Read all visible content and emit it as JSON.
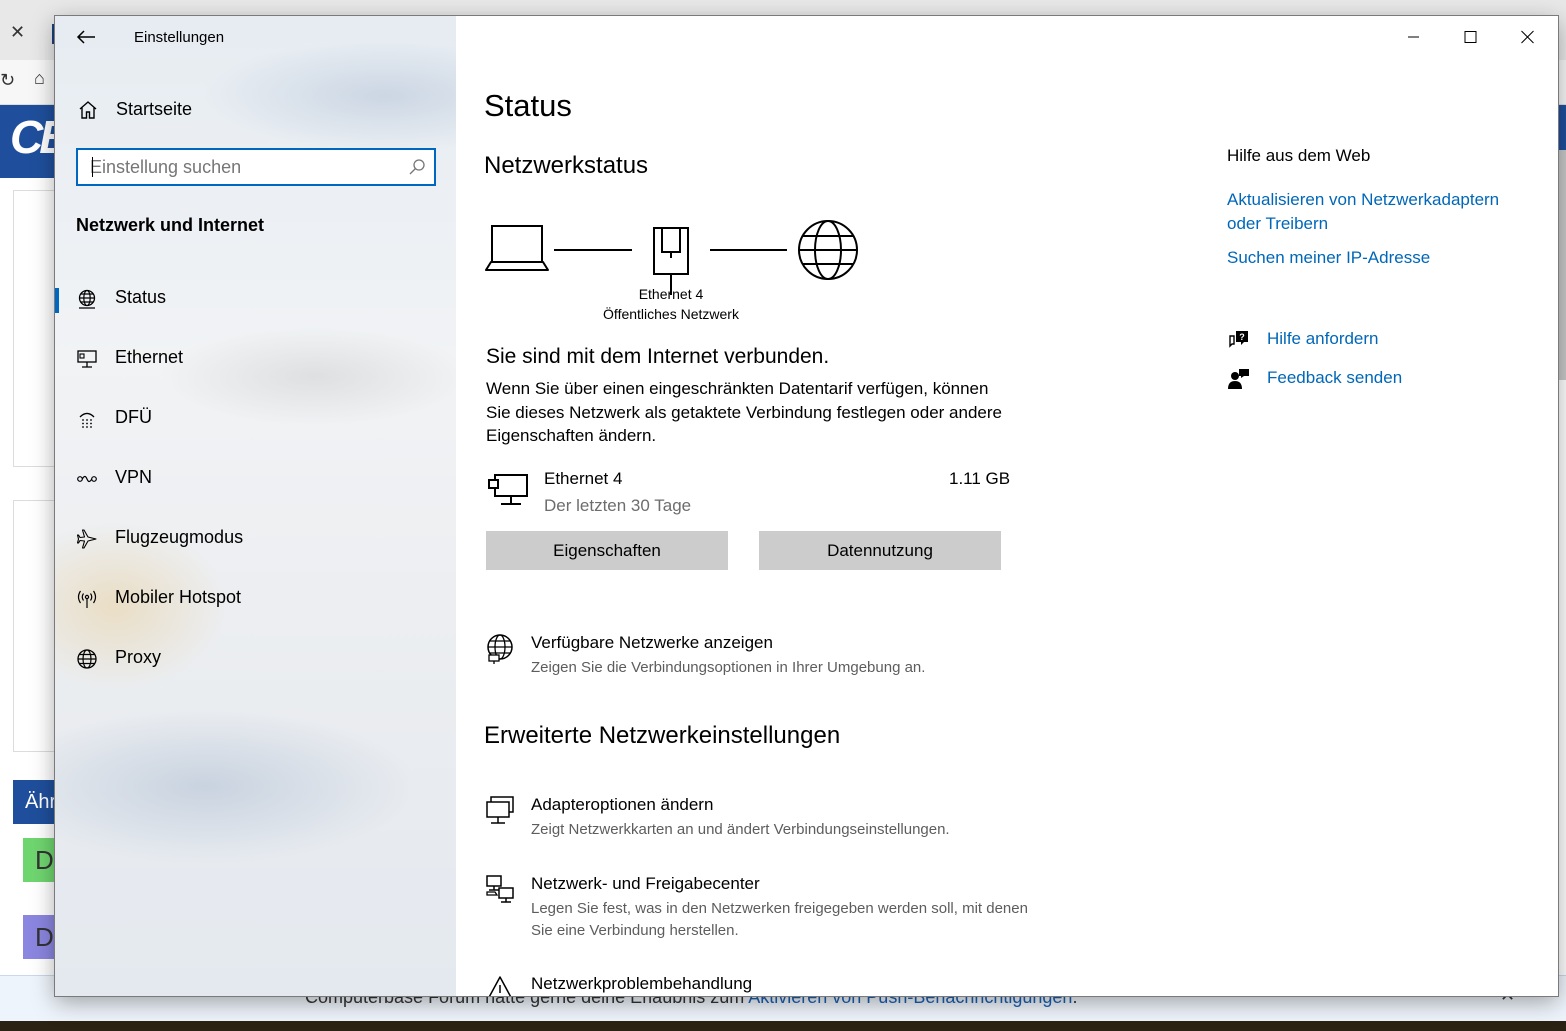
{
  "background": {
    "logo_text": "CB",
    "similar_label": "Ähr",
    "avatar1": "D",
    "avatar2": "D",
    "notification_text": "Computerbase Forum hätte gerne deine Erlaubnis zum ",
    "notification_link": "Aktivieren von Push-Benachrichtigungen",
    "notification_end": "."
  },
  "window": {
    "title": "Einstellungen"
  },
  "sidebar": {
    "home_label": "Startseite",
    "search_placeholder": "Einstellung suchen",
    "section_title": "Netzwerk und Internet",
    "items": [
      {
        "label": "Status",
        "icon": "globe-network-icon",
        "selected": true
      },
      {
        "label": "Ethernet",
        "icon": "ethernet-icon",
        "selected": false
      },
      {
        "label": "DFÜ",
        "icon": "dialup-icon",
        "selected": false
      },
      {
        "label": "VPN",
        "icon": "vpn-icon",
        "selected": false
      },
      {
        "label": "Flugzeugmodus",
        "icon": "airplane-icon",
        "selected": false
      },
      {
        "label": "Mobiler Hotspot",
        "icon": "hotspot-icon",
        "selected": false
      },
      {
        "label": "Proxy",
        "icon": "globe-icon",
        "selected": false
      }
    ]
  },
  "main": {
    "title": "Status",
    "network_status_heading": "Netzwerkstatus",
    "adapter_caption_line1": "Ethernet 4",
    "adapter_caption_line2": "Öffentliches Netzwerk",
    "connected_text": "Sie sind mit dem Internet verbunden.",
    "connected_desc": "Wenn Sie über einen eingeschränkten Datentarif verfügen, können Sie dieses Netzwerk als getaktete Verbindung festlegen oder andere Eigenschaften ändern.",
    "adapter": {
      "name": "Ethernet 4",
      "period": "Der letzten 30 Tage",
      "usage": "1.11 GB"
    },
    "buttons": {
      "properties": "Eigenschaften",
      "data_usage": "Datennutzung"
    },
    "available_networks": {
      "title": "Verfügbare Netzwerke anzeigen",
      "subtitle": "Zeigen Sie die Verbindungsoptionen in Ihrer Umgebung an."
    },
    "advanced_heading": "Erweiterte Netzwerkeinstellungen",
    "advanced_items": [
      {
        "title": "Adapteroptionen ändern",
        "subtitle": "Zeigt Netzwerkkarten an und ändert Verbindungseinstellungen."
      },
      {
        "title": "Netzwerk- und Freigabecenter",
        "subtitle": "Legen Sie fest, was in den Netzwerken freigegeben werden soll, mit denen Sie eine Verbindung herstellen."
      },
      {
        "title": "Netzwerkproblembehandlung",
        "subtitle": ""
      }
    ]
  },
  "help": {
    "title": "Hilfe aus dem Web",
    "links": [
      "Aktualisieren von Netzwerkadaptern oder Treibern",
      "Suchen meiner IP-Adresse"
    ],
    "get_help": "Hilfe anfordern",
    "feedback": "Feedback senden"
  },
  "colors": {
    "accent": "#0067c0",
    "link": "#0067b8",
    "button_bg": "#cccccc"
  }
}
